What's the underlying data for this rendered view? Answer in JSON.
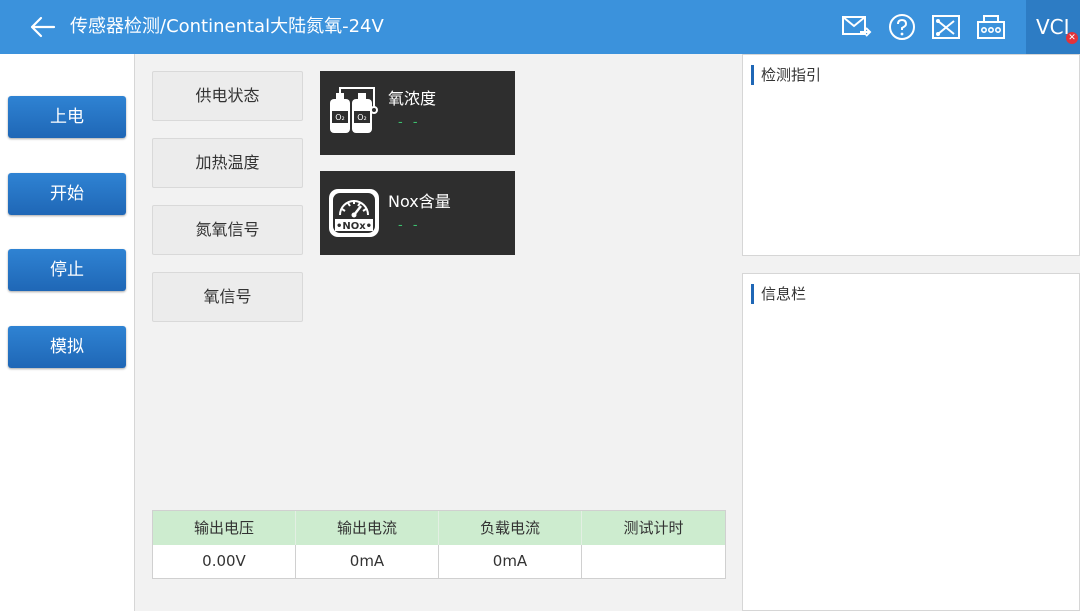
{
  "header": {
    "title": "传感器检测/Continental大陆氮氧-24V",
    "vci_label": "VCI"
  },
  "sidebar": {
    "buttons": [
      "上电",
      "开始",
      "停止",
      "模拟"
    ]
  },
  "items": [
    "供电状态",
    "加热温度",
    "氮氧信号",
    "氧信号"
  ],
  "tiles": [
    {
      "label": "氧浓度",
      "value": "- -",
      "icon": "oxygen-tanks-icon",
      "icon_text": "O₂"
    },
    {
      "label": "Nox含量",
      "value": "- -",
      "icon": "nox-gauge-icon",
      "icon_text": "•NOx•"
    }
  ],
  "table": {
    "headers": [
      "输出电压",
      "输出电流",
      "负载电流",
      "测试计时"
    ],
    "values": [
      "0.00V",
      "0mA",
      "0mA",
      ""
    ]
  },
  "panels": {
    "guide_title": "检测指引",
    "info_title": "信息栏"
  },
  "colors": {
    "header_bg": "#3b92dc",
    "button_blue": "#1f67b6",
    "tile_bg": "#2e2e2e",
    "value_green": "#3cc06e",
    "table_header_bg": "#cdeccf"
  }
}
